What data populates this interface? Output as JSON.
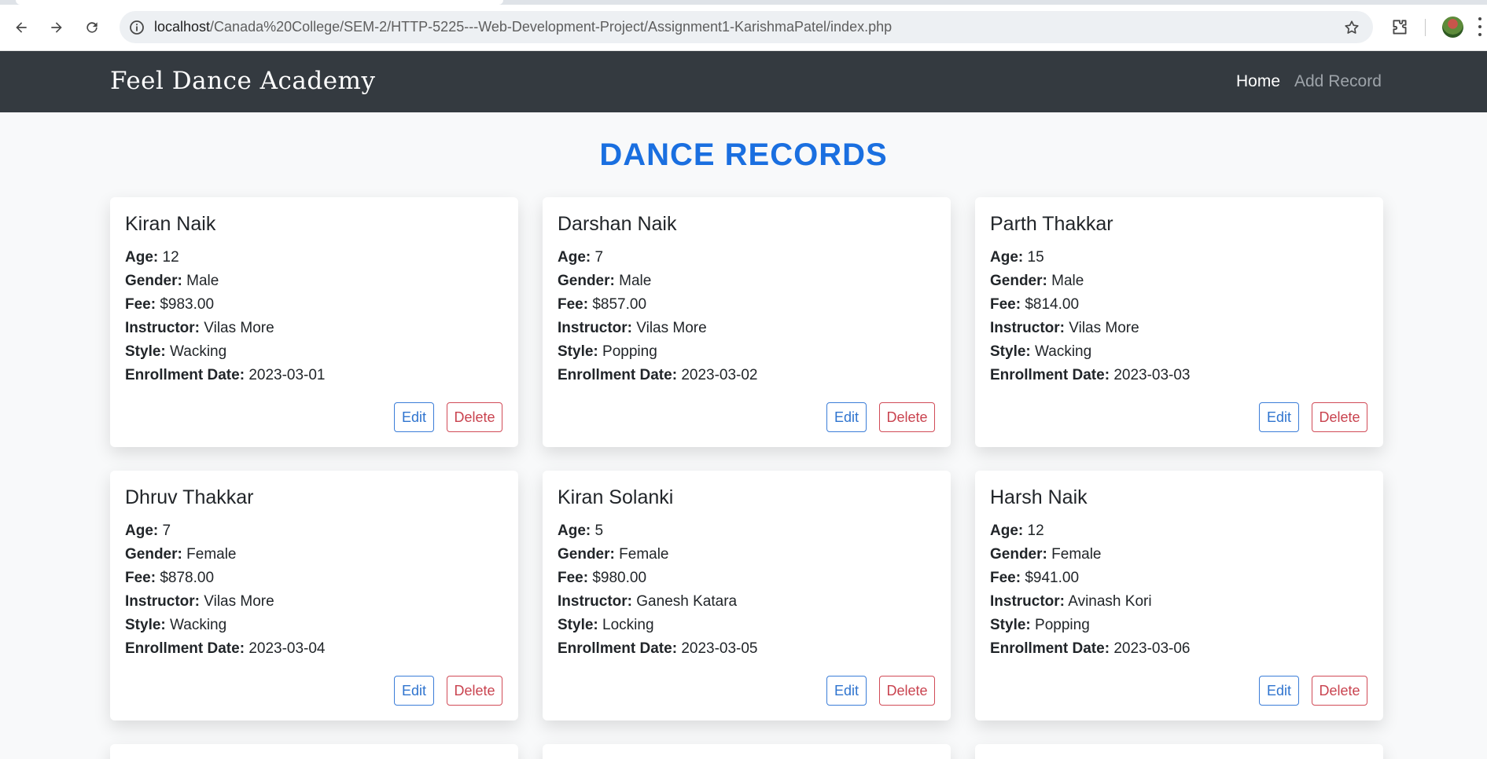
{
  "browser": {
    "url_host": "localhost",
    "url_path": "/Canada%20College/SEM-2/HTTP-5225---Web-Development-Project/Assignment1-KarishmaPatel/index.php"
  },
  "navbar": {
    "brand": "Feel Dance Academy",
    "links": [
      {
        "label": "Home"
      },
      {
        "label": "Add Record"
      }
    ]
  },
  "page": {
    "title": "DANCE RECORDS"
  },
  "labels": {
    "age": "Age:",
    "gender": "Gender:",
    "fee": "Fee:",
    "instructor": "Instructor:",
    "style": "Style:",
    "enrollment_date": "Enrollment Date:",
    "edit": "Edit",
    "delete": "Delete"
  },
  "records": [
    {
      "name": "Kiran Naik",
      "age": "12",
      "gender": "Male",
      "fee": "$983.00",
      "instructor": "Vilas More",
      "style": "Wacking",
      "enrollment_date": "2023-03-01"
    },
    {
      "name": "Darshan Naik",
      "age": "7",
      "gender": "Male",
      "fee": "$857.00",
      "instructor": "Vilas More",
      "style": "Popping",
      "enrollment_date": "2023-03-02"
    },
    {
      "name": "Parth Thakkar",
      "age": "15",
      "gender": "Male",
      "fee": "$814.00",
      "instructor": "Vilas More",
      "style": "Wacking",
      "enrollment_date": "2023-03-03"
    },
    {
      "name": "Dhruv Thakkar",
      "age": "7",
      "gender": "Female",
      "fee": "$878.00",
      "instructor": "Vilas More",
      "style": "Wacking",
      "enrollment_date": "2023-03-04"
    },
    {
      "name": "Kiran Solanki",
      "age": "5",
      "gender": "Female",
      "fee": "$980.00",
      "instructor": "Ganesh Katara",
      "style": "Locking",
      "enrollment_date": "2023-03-05"
    },
    {
      "name": "Harsh Naik",
      "age": "12",
      "gender": "Female",
      "fee": "$941.00",
      "instructor": "Avinash Kori",
      "style": "Popping",
      "enrollment_date": "2023-03-06"
    }
  ],
  "colors": {
    "navbar_bg": "#343a40",
    "title": "#1a6fe0",
    "edit": "#2f74cf",
    "delete": "#c9434f"
  }
}
